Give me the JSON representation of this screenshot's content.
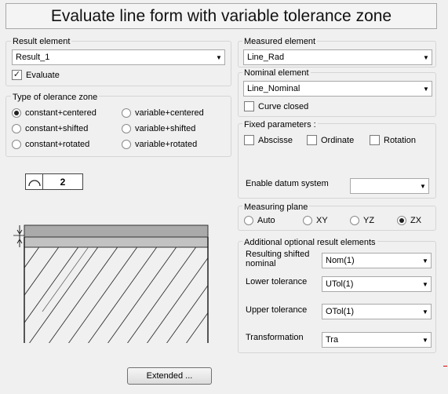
{
  "title": "Evaluate line form with variable tolerance zone",
  "result_element": {
    "label": "Result element",
    "value": "Result_1",
    "evaluate_label": "Evaluate",
    "evaluate_checked": "✓"
  },
  "tolerance_zone": {
    "label": "Type of olerance zone",
    "options": [
      "constant+centered",
      "variable+centered",
      "constant+shifted",
      "variable+shifted",
      "constant+rotated",
      "variable+rotated"
    ],
    "selected": "constant+centered"
  },
  "profile_symbol": {
    "value": "2"
  },
  "measured_element": {
    "label": "Measured element",
    "value": "Line_Rad"
  },
  "nominal_element": {
    "label": "Nominal element",
    "value": "Line_Nominal",
    "curve_closed_label": "Curve closed"
  },
  "fixed_parameters": {
    "label": "Fixed parameters :",
    "abscisse": "Abscisse",
    "ordinate": "Ordinate",
    "rotation": "Rotation",
    "datum_label": "Enable datum system",
    "datum_value": ""
  },
  "measuring_plane": {
    "label": "Measuring plane",
    "options": [
      "Auto",
      "XY",
      "YZ",
      "ZX"
    ],
    "selected": "ZX"
  },
  "optional_results": {
    "label": "Additional optional result elements",
    "shifted_nominal_label": "Resulting shifted nominal",
    "shifted_nominal_value": "Nom(1)",
    "lower_label": "Lower tolerance",
    "lower_value": "UTol(1)",
    "upper_label": "Upper tolerance",
    "upper_value": "OTol(1)",
    "transformation_label": "Transformation",
    "transformation_value": "Tra"
  },
  "extended_button": "Extended ..."
}
